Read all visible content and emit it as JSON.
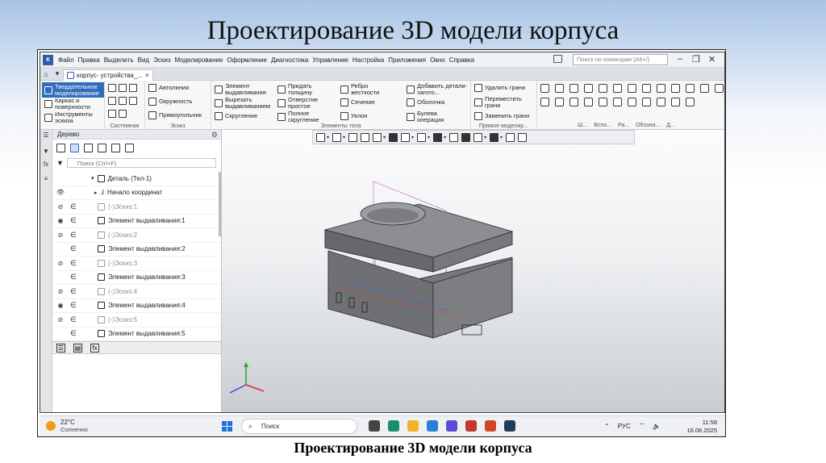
{
  "slide": {
    "title": "Проектирование 3D модели корпуса",
    "caption": "Проектирование 3D модели корпуса"
  },
  "menu": {
    "items": [
      "Файл",
      "Правка",
      "Выделить",
      "Вид",
      "Эскиз",
      "Моделирование",
      "Оформление",
      "Диагностика",
      "Управление",
      "Настройка",
      "Приложения",
      "Окно",
      "Справка"
    ],
    "command_search_placeholder": "Поиск по командам (Alt+/)"
  },
  "document_tab": {
    "label": "корпус- устройства_...",
    "close": "×"
  },
  "ribbon": {
    "mode_buttons": [
      "Твердотельное моделирование",
      "Каркас и поверхности",
      "Инструменты эскиза"
    ],
    "system_label": "Системная",
    "sketch_buttons": [
      "Автолиния",
      "Окружность",
      "Прямоугольник"
    ],
    "sketch_label": "Эскиз",
    "body_col1": [
      "Элемент выдавливания",
      "Вырезать выдавливанием",
      "Скругление"
    ],
    "body_col2": [
      "Придать толщину",
      "Отверстие простое",
      "Полное скругление"
    ],
    "body_col3": [
      "Ребро жесткости",
      "Сечение",
      "Уклон"
    ],
    "body_col4": [
      "Добавить детали-загото...",
      "Оболочка",
      "Булева операция"
    ],
    "body_label": "Элементы тела",
    "direct_buttons": [
      "Удалить грани",
      "Переместить грани",
      "Заменить грани"
    ],
    "direct_label": "Прямое моделир...",
    "bottom_labels": [
      "Ш...",
      "Вспо...",
      "Ра...",
      "Обозна...",
      "Д..."
    ]
  },
  "tree": {
    "title": "Дерево",
    "search_placeholder": "Поиск (Ctrl+F)",
    "root": "Деталь (Тел-1)",
    "origin": "Начало координат",
    "rows": [
      {
        "label": "(-)Эскиз:1",
        "eye": "hidden",
        "dim": true
      },
      {
        "label": "Элемент выдавливания:1",
        "eye": "visible",
        "dim": false
      },
      {
        "label": "(-)Эскиз:2",
        "eye": "hidden",
        "dim": true
      },
      {
        "label": "Элемент выдавливания:2",
        "eye": "none",
        "dim": false
      },
      {
        "label": "(-)Эскиз:3",
        "eye": "hidden",
        "dim": true
      },
      {
        "label": "Элемент выдавливания:3",
        "eye": "none",
        "dim": false
      },
      {
        "label": "(-)Эскиз:4",
        "eye": "hidden",
        "dim": true
      },
      {
        "label": "Элемент выдавливания:4",
        "eye": "visible",
        "dim": false
      },
      {
        "label": "(-)Эскиз:5",
        "eye": "hidden",
        "dim": true
      },
      {
        "label": "Элемент выдавливания:5",
        "eye": "none",
        "dim": false
      }
    ],
    "fx_label": "fx"
  },
  "taskbar": {
    "temperature": "22°C",
    "weather": "Солнечно",
    "search_label": "Поиск",
    "language": "РУС",
    "time": "11:58",
    "date": "16.06.2025"
  },
  "colors": {
    "accent": "#316dbb",
    "model_top": "#8a8c8f",
    "model_side": "#6e7073"
  }
}
